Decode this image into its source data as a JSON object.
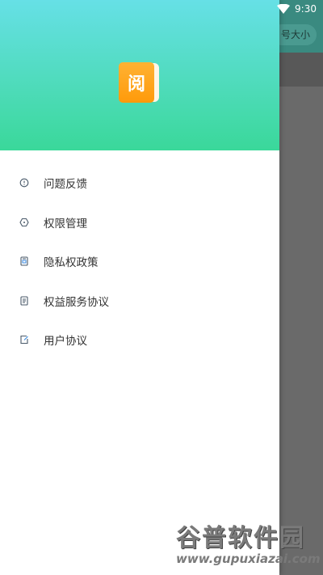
{
  "status_bar": {
    "time": "9:30",
    "wifi_icon": "wifi-icon"
  },
  "background_app": {
    "pill_label": "号大小"
  },
  "drawer": {
    "header_gradient": [
      "#66e0e6",
      "#3ad89a"
    ],
    "logo": {
      "glyph": "阅",
      "color": "#ff9a0a"
    },
    "menu_items": [
      {
        "label": "问题反馈",
        "icon": "feedback-icon"
      },
      {
        "label": "权限管理",
        "icon": "permission-icon"
      },
      {
        "label": "隐私权政策",
        "icon": "privacy-icon"
      },
      {
        "label": "权益服务协议",
        "icon": "document-icon"
      },
      {
        "label": "用户协议",
        "icon": "edit-icon"
      }
    ]
  },
  "watermark": {
    "title": "谷普软件园",
    "url": "www.gupuxiazai.com"
  }
}
